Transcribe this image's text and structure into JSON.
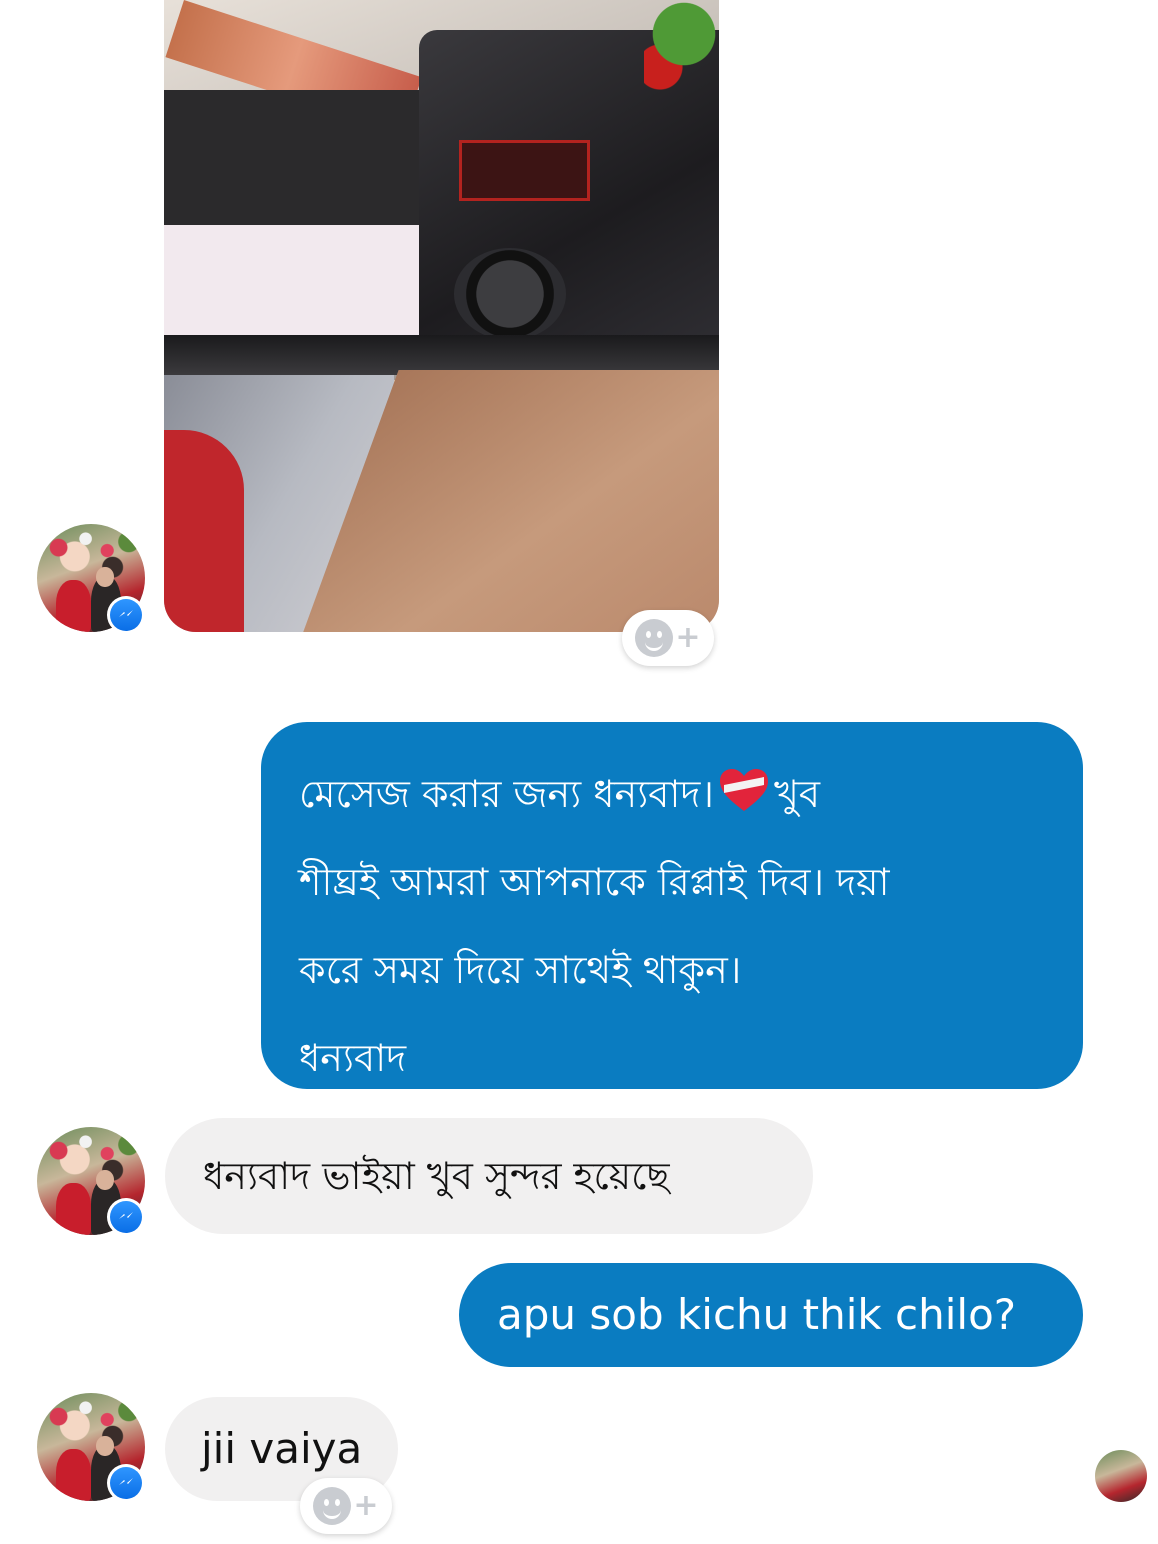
{
  "conversation": {
    "shared_photo": {
      "alt": "",
      "reaction_button": "add-reaction"
    },
    "messages": [
      {
        "from": "me",
        "lines": [
          "মেসেজ করার জন্য ধন্যবাদ।",
          "খুব",
          "শীঘ্রই আমরা আপনাকে রিপ্লাই দিব। দয়া",
          "করে সময় দিয়ে সাথেই থাকুন।",
          "ধন্যবাদ"
        ],
        "emoji": "heart-with-ribbon-icon"
      },
      {
        "from": "contact",
        "text": "ধন্যবাদ ভাইয়া খুব সুন্দর হয়েছে"
      },
      {
        "from": "me",
        "text": "apu sob kichu thik chilo?"
      },
      {
        "from": "contact",
        "text": "jii vaiya"
      }
    ]
  },
  "colors": {
    "outgoing_bubble": "#0a7cc1",
    "incoming_bubble": "#f1f0f0",
    "messenger_badge": "#0a6ee6"
  },
  "icons": {
    "reaction": "smiley-plus-icon",
    "badge": "messenger-icon"
  }
}
